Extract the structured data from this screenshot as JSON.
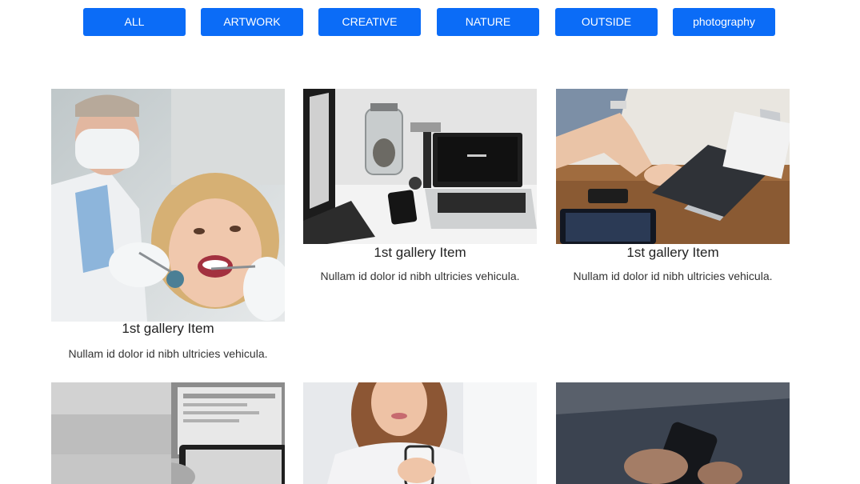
{
  "filters": [
    {
      "label": "ALL"
    },
    {
      "label": "ARTWORK"
    },
    {
      "label": "CREATIVE"
    },
    {
      "label": "NATURE"
    },
    {
      "label": "OUTSIDE"
    },
    {
      "label": "photography"
    }
  ],
  "gallery": {
    "items": [
      {
        "title": "1st gallery Item",
        "text": "Nullam id dolor id nibh ultricies vehicula.",
        "image": "dentist-patient-photo"
      },
      {
        "title": "1st gallery Item",
        "text": "Nullam id dolor id nibh ultricies vehicula.",
        "image": "laptop-desk-photo"
      },
      {
        "title": "1st gallery Item",
        "text": "Nullam id dolor id nibh ultricies vehicula.",
        "image": "typing-laptop-photo"
      },
      {
        "title": "",
        "text": "",
        "image": "tablet-laptop-photo"
      },
      {
        "title": "",
        "text": "",
        "image": "woman-phone-photo"
      },
      {
        "title": "",
        "text": "",
        "image": "hands-phone-photo"
      }
    ]
  },
  "colors": {
    "filter_bg": "#0b6cf7",
    "filter_text": "#ffffff",
    "title_text": "#222222",
    "body_text": "#333333"
  }
}
